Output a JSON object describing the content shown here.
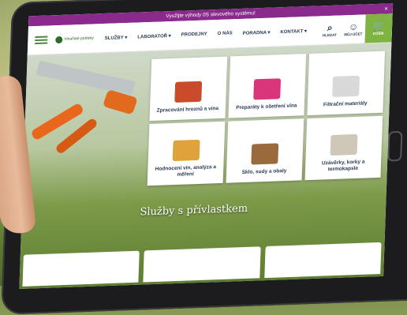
{
  "promo": {
    "text": "Využijte výhody 0S slevového systému!",
    "close": "×"
  },
  "logo": {
    "text": "Vinařské potřeby"
  },
  "nav": {
    "items": [
      {
        "label": "SLUŽBY ▾"
      },
      {
        "label": "LABORATOŘ ▾"
      },
      {
        "label": "PRODEJNY"
      },
      {
        "label": "O NÁS"
      },
      {
        "label": "PORADNA ▾"
      },
      {
        "label": "KONTAKT ▾"
      }
    ],
    "search_label": "HLEDAT",
    "account_label": "MŮJ ÚČET",
    "cart_label": "KOŠÍK",
    "cart_count": "0"
  },
  "tiles": [
    {
      "label": "Zpracování hroznů a vína",
      "icon": "press-machine-icon",
      "color": "#c94b2b"
    },
    {
      "label": "Preparáty k ošetření vína",
      "icon": "preparation-can-icon",
      "color": "#d8357a"
    },
    {
      "label": "Filtrační materiály",
      "icon": "filter-sheets-icon",
      "color": "#d9d9d9"
    },
    {
      "label": "Hodnocení vín, analýza a měření",
      "icon": "lab-bottles-icon",
      "color": "#e0a23a"
    },
    {
      "label": "Sklo, sudy a obaly",
      "icon": "barrels-icon",
      "color": "#9a6a3a"
    },
    {
      "label": "Uzávěrky, korky a termokapsle",
      "icon": "corks-icon",
      "color": "#cfc7b8"
    }
  ],
  "hero": {
    "subtitle": "Služby s přívlastkem"
  },
  "colors": {
    "accent": "#8a2a8c",
    "brand": "#7fb342",
    "text": "#2a3b55"
  }
}
